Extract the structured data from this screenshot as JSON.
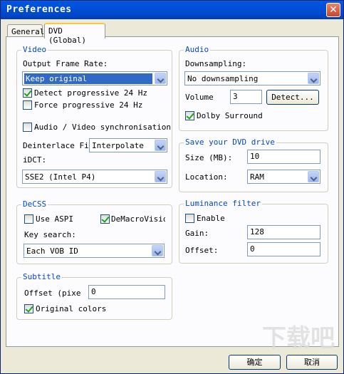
{
  "window": {
    "title": "Preferences",
    "close_glyph": "✕"
  },
  "tabs": [
    {
      "label": "General",
      "active": false
    },
    {
      "label": "DVD (Global)",
      "active": true
    }
  ],
  "video": {
    "title": "Video",
    "frame_rate_label": "Output Frame Rate:",
    "frame_rate_value": "Keep original",
    "detect_label": "Detect progressive 24 Hz",
    "detect_checked": true,
    "force_label": "Force progressive 24 Hz",
    "force_checked": false,
    "av_sync_label": "Audio / Video synchronisation",
    "av_sync_checked": false,
    "deinterlace_label": "Deinterlace Fil",
    "deinterlace_value": "Interpolate",
    "idct_label": "iDCT:",
    "idct_value": "SSE2 (Intel P4)"
  },
  "decss": {
    "title": "DeCSS",
    "aspi_label": "Use ASPI",
    "aspi_checked": false,
    "demacro_label": "DeMacroVisio",
    "demacro_checked": true,
    "key_search_label": "Key search:",
    "key_search_value": "Each VOB ID"
  },
  "subtitle": {
    "title": "Subtitle",
    "offset_label": "Offset (pixe",
    "offset_value": "0",
    "orig_colors_label": "Original colors",
    "orig_colors_checked": true
  },
  "audio": {
    "title": "Audio",
    "downsampling_label": "Downsampling:",
    "downsampling_value": "No downsampling",
    "volume_label": "Volume",
    "volume_value": "3",
    "detect_button": "Detect...",
    "dolby_label": "Dolby Surround",
    "dolby_checked": true
  },
  "save_drive": {
    "title": "Save your DVD drive",
    "size_label": "Size (MB):",
    "size_value": "10",
    "location_label": "Location:",
    "location_value": "RAM"
  },
  "luminance": {
    "title": "Luminance filter",
    "enable_label": "Enable",
    "enable_checked": false,
    "gain_label": "Gain:",
    "gain_value": "128",
    "offset_label": "Offset:",
    "offset_value": "0"
  },
  "footer": {
    "ok_label": "确定",
    "cancel_label": "取消"
  },
  "watermark": "下载吧"
}
